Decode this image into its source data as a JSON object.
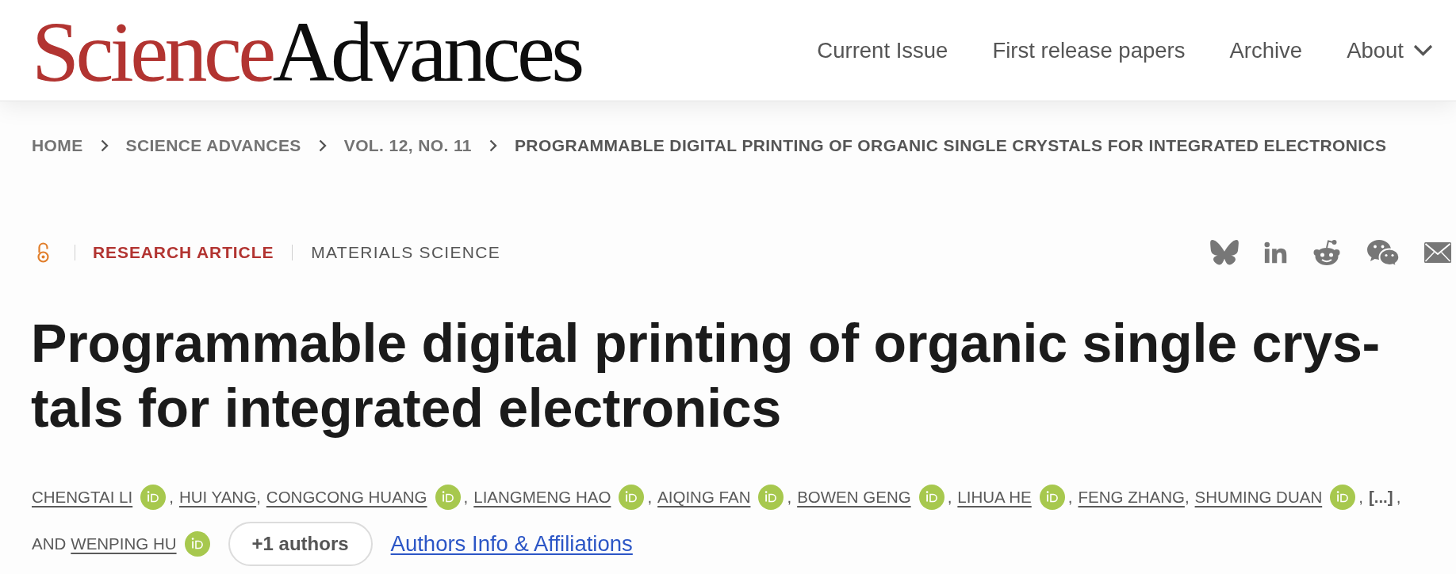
{
  "header": {
    "logo": {
      "primary": "Science",
      "secondary": "Advances"
    },
    "nav": [
      {
        "label": "Current Issue",
        "has_menu": false
      },
      {
        "label": "First release papers",
        "has_menu": false
      },
      {
        "label": "Archive",
        "has_menu": false
      },
      {
        "label": "About",
        "has_menu": true
      }
    ]
  },
  "breadcrumb": [
    {
      "label": "HOME",
      "current": false
    },
    {
      "label": "SCIENCE ADVANCES",
      "current": false
    },
    {
      "label": "VOL. 12, NO. 11",
      "current": false
    },
    {
      "label": "PROGRAMMABLE DIGITAL PRINTING OF ORGANIC SINGLE CRYSTALS FOR INTEGRATED ELECTRONICS",
      "current": true
    }
  ],
  "article": {
    "open_access": true,
    "article_type": "RESEARCH ARTICLE",
    "subject": "MATERIALS SCIENCE",
    "title": "Programmable digital printing of organic single crys-tals for integrated electronics",
    "authors": [
      {
        "kind": "author",
        "name": "CHENGTAI LI",
        "orcid": true,
        "separator": ","
      },
      {
        "kind": "author",
        "name": "HUI YANG",
        "orcid": false,
        "separator": ","
      },
      {
        "kind": "author",
        "name": "CONGCONG HUANG",
        "orcid": true,
        "separator": ","
      },
      {
        "kind": "author",
        "name": "LIANGMENG HAO",
        "orcid": true,
        "separator": ","
      },
      {
        "kind": "author",
        "name": "AIQING FAN",
        "orcid": true,
        "separator": ","
      },
      {
        "kind": "author",
        "name": "BOWEN GENG",
        "orcid": true,
        "separator": ","
      },
      {
        "kind": "author",
        "name": "LIHUA HE",
        "orcid": true,
        "separator": ","
      },
      {
        "kind": "author",
        "name": "FENG ZHANG",
        "orcid": false,
        "separator": ","
      },
      {
        "kind": "author",
        "name": "SHUMING DUAN",
        "orcid": true,
        "separator": ","
      },
      {
        "kind": "collapsed",
        "label": "[...]",
        "separator": ","
      },
      {
        "kind": "author",
        "prefix": "AND",
        "name": "WENPING HU",
        "orcid": true
      }
    ],
    "more_authors_button": "+1 authors",
    "affiliations_link": "Authors Info & Affiliations"
  }
}
